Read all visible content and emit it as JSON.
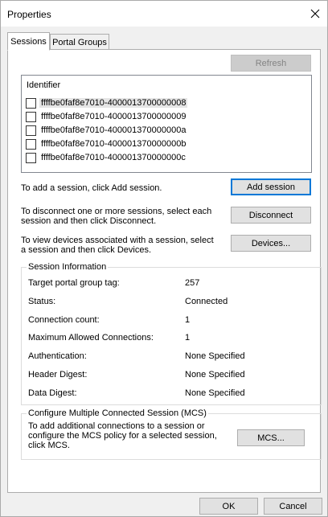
{
  "dialog": {
    "title": "Properties"
  },
  "tabs": [
    {
      "label": "Sessions"
    },
    {
      "label": "Portal Groups"
    }
  ],
  "buttons": {
    "refresh": "Refresh",
    "add_session": "Add session",
    "disconnect": "Disconnect",
    "devices": "Devices...",
    "mcs": "MCS...",
    "ok": "OK",
    "cancel": "Cancel"
  },
  "session_list": {
    "header": "Identifier",
    "items": [
      {
        "id": "ffffbe0faf8e7010-4000013700000008",
        "checked": false
      },
      {
        "id": "ffffbe0faf8e7010-4000013700000009",
        "checked": false
      },
      {
        "id": "ffffbe0faf8e7010-400001370000000a",
        "checked": false
      },
      {
        "id": "ffffbe0faf8e7010-400001370000000b",
        "checked": false
      },
      {
        "id": "ffffbe0faf8e7010-400001370000000c",
        "checked": false
      }
    ]
  },
  "instructions": {
    "add": "To add a session, click Add session.",
    "disconnect_line1": "To disconnect one or more sessions, select each",
    "disconnect_line2": "session and then click Disconnect.",
    "devices_line1": "To view devices associated with a session, select",
    "devices_line2": "a session and then click Devices."
  },
  "session_info": {
    "legend": "Session Information",
    "rows": [
      {
        "label": "Target portal group tag:",
        "value": "257"
      },
      {
        "label": "Status:",
        "value": "Connected"
      },
      {
        "label": "Connection count:",
        "value": "1"
      },
      {
        "label": "Maximum Allowed Connections:",
        "value": "1"
      },
      {
        "label": "Authentication:",
        "value": "None Specified"
      },
      {
        "label": "Header Digest:",
        "value": "None Specified"
      },
      {
        "label": "Data Digest:",
        "value": "None Specified"
      }
    ]
  },
  "mcs": {
    "legend": "Configure Multiple Connected Session (MCS)",
    "line1": "To add additional connections to a session or",
    "line2": "configure the MCS policy for a selected session,",
    "line3": "click MCS."
  },
  "icons": {
    "close": "close-icon"
  },
  "colors": {
    "default_button_border": "#0078d7",
    "disabled_button_bg": "#cccccc",
    "window_bg": "#f0f0f0"
  }
}
